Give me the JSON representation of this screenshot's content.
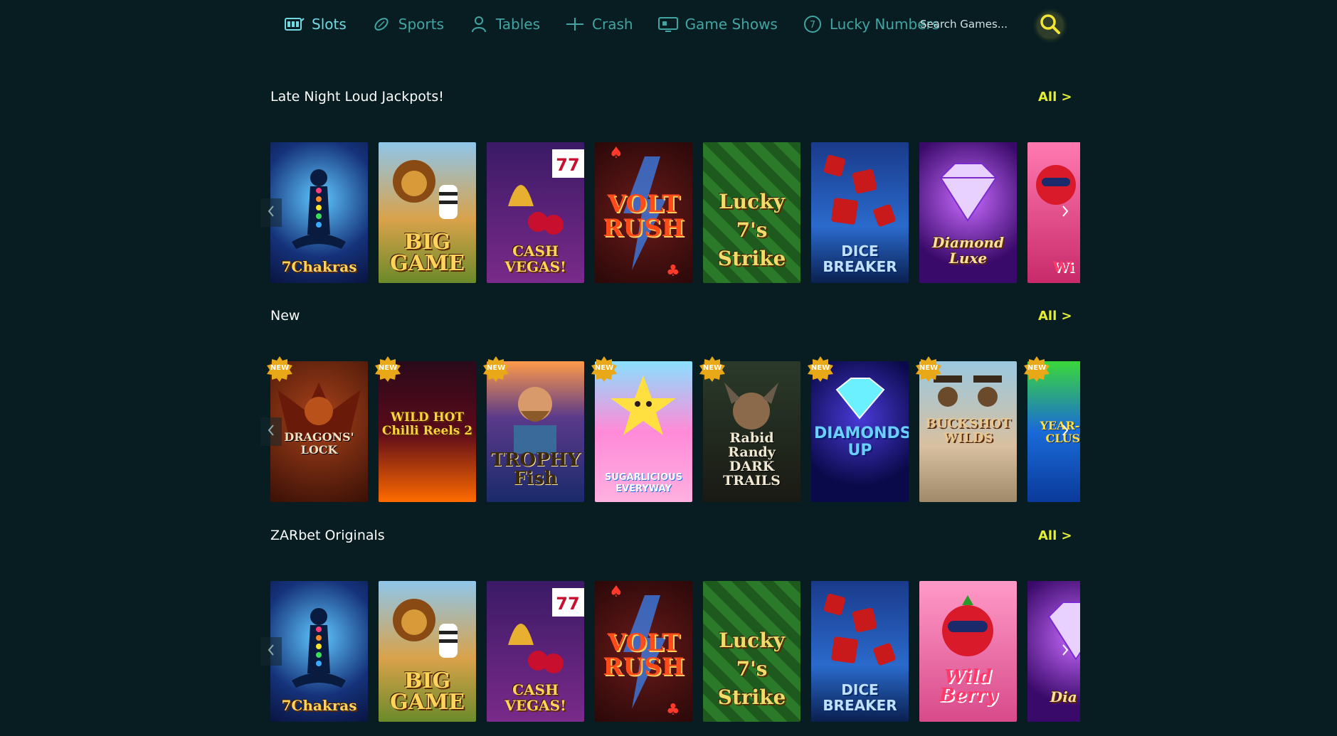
{
  "nav": {
    "items": [
      {
        "label": "Slots",
        "icon": "slot-machine-icon",
        "active": true
      },
      {
        "label": "Sports",
        "icon": "football-icon"
      },
      {
        "label": "Tables",
        "icon": "dealer-icon"
      },
      {
        "label": "Crash",
        "icon": "airplane-icon"
      },
      {
        "label": "Game Shows",
        "icon": "tv-icon"
      },
      {
        "label": "Lucky Numbers",
        "icon": "lucky-numbers-icon"
      }
    ],
    "search_placeholder": "Search Games...",
    "search_icon": "search-icon"
  },
  "sections": [
    {
      "title": "Late Night Loud Jackpots!",
      "all_label": "All >",
      "games": [
        {
          "name": "7Chakras",
          "display": "7Chakras"
        },
        {
          "name": "Big Game",
          "display": "BIG GAME"
        },
        {
          "name": "Cash Vegas",
          "display": "CASH VEGAS!"
        },
        {
          "name": "Volt Rush",
          "display": "VOLT RUSH"
        },
        {
          "name": "Lucky 7's Strike",
          "display": "Lucky 7's Strike"
        },
        {
          "name": "Dice Breaker",
          "display": "DICE BREAKER"
        },
        {
          "name": "Diamond Luxe",
          "display": "Diamond Luxe"
        },
        {
          "name": "Wild Berry",
          "display": "Wi Be"
        }
      ]
    },
    {
      "title": "New",
      "all_label": "All >",
      "badge": "NEW",
      "games": [
        {
          "name": "Dragons' Lock",
          "display": "DRAGONS' LOCK"
        },
        {
          "name": "Wild Hot Chilli Reels 2",
          "display": "WILD HOT Chilli Reels 2"
        },
        {
          "name": "Trophy Fish",
          "display": "TROPHY Fish"
        },
        {
          "name": "Sugarlicious Everyway",
          "display": "SUGARLICIOUS EVERYWAY"
        },
        {
          "name": "Rabid Randy Dark Trails",
          "display": "Rabid Randy DARK TRAILS"
        },
        {
          "name": "Diamonds Up",
          "display": "DIAMONDS UP"
        },
        {
          "name": "Buckshot Wilds",
          "display": "BUCKSHOT WILDS"
        },
        {
          "name": "Year-Round Cluster",
          "display": "YEAR-R RO CLUSTER"
        }
      ]
    },
    {
      "title": "ZARbet Originals",
      "all_label": "All >",
      "games": [
        {
          "name": "7Chakras",
          "display": "7Chakras"
        },
        {
          "name": "Big Game",
          "display": "BIG GAME"
        },
        {
          "name": "Cash Vegas",
          "display": "CASH VEGAS!"
        },
        {
          "name": "Volt Rush",
          "display": "VOLT RUSH"
        },
        {
          "name": "Lucky 7's Strike",
          "display": "Lucky 7's Strike"
        },
        {
          "name": "Dice Breaker",
          "display": "DICE BREAKER"
        },
        {
          "name": "Wild Berry",
          "display": "Wild Berry"
        },
        {
          "name": "Diamond Luxe",
          "display": "Dia Lu"
        }
      ]
    }
  ],
  "colors": {
    "background": "#071d22",
    "nav_text": "#41a6a3",
    "nav_active": "#6fd9e4",
    "accent_all": "#e6ee34"
  }
}
